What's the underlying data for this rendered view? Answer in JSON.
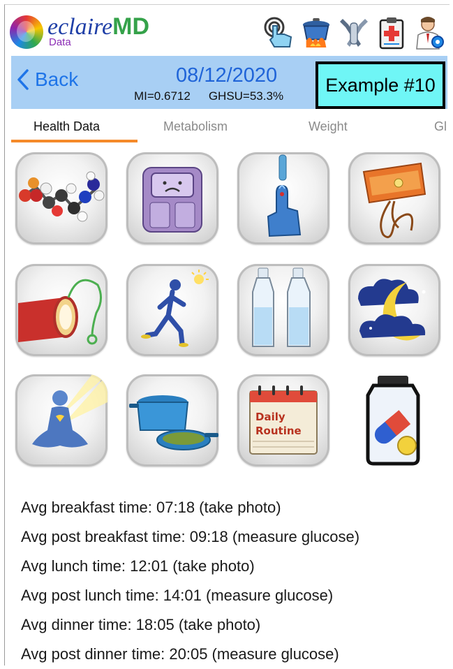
{
  "app": {
    "logo_word": "eclaire",
    "logo_md": "MD",
    "logo_sub": "Data"
  },
  "header_icons": [
    "touch-hand-icon",
    "cooking-pot-icon",
    "utensils-icon",
    "clipboard-icon",
    "doctor-settings-icon"
  ],
  "navbar": {
    "back_label": "Back",
    "date": "08/12/2020",
    "mi": "MI=0.6712",
    "ghsu": "GHSU=53.3%",
    "example_label": "Example #10"
  },
  "tabs": [
    {
      "label": "Health Data",
      "active": true
    },
    {
      "label": "Metabolism",
      "active": false
    },
    {
      "label": "Weight",
      "active": false
    },
    {
      "label": "Gl",
      "active": false
    }
  ],
  "grid_icons": [
    "molecule-icon",
    "weight-scale-icon",
    "glucose-finger-prick-icon",
    "blood-pressure-cuff-icon",
    "artery-stethoscope-icon",
    "walking-exercise-icon",
    "water-bottles-icon",
    "sleep-moon-icon",
    "meditation-icon",
    "cookware-icon",
    "daily-routine-calendar-icon",
    "medication-bottle-icon"
  ],
  "calendar_text": {
    "line1": "Daily",
    "line2": "Routine"
  },
  "info_lines": [
    "Avg breakfast time: 07:18 (take photo)",
    "Avg post breakfast time: 09:18 (measure glucose)",
    "Avg lunch time: 12:01 (take photo)",
    "Avg post lunch time: 14:01 (measure glucose)",
    "Avg dinner time: 18:05 (take photo)",
    "Avg post dinner time: 20:05 (measure glucose)"
  ],
  "colors": {
    "navbar_bg": "#a8cff4",
    "link_blue": "#1e74e8",
    "example_bg": "#6ff6f6",
    "tab_underline": "#f58a2a"
  }
}
